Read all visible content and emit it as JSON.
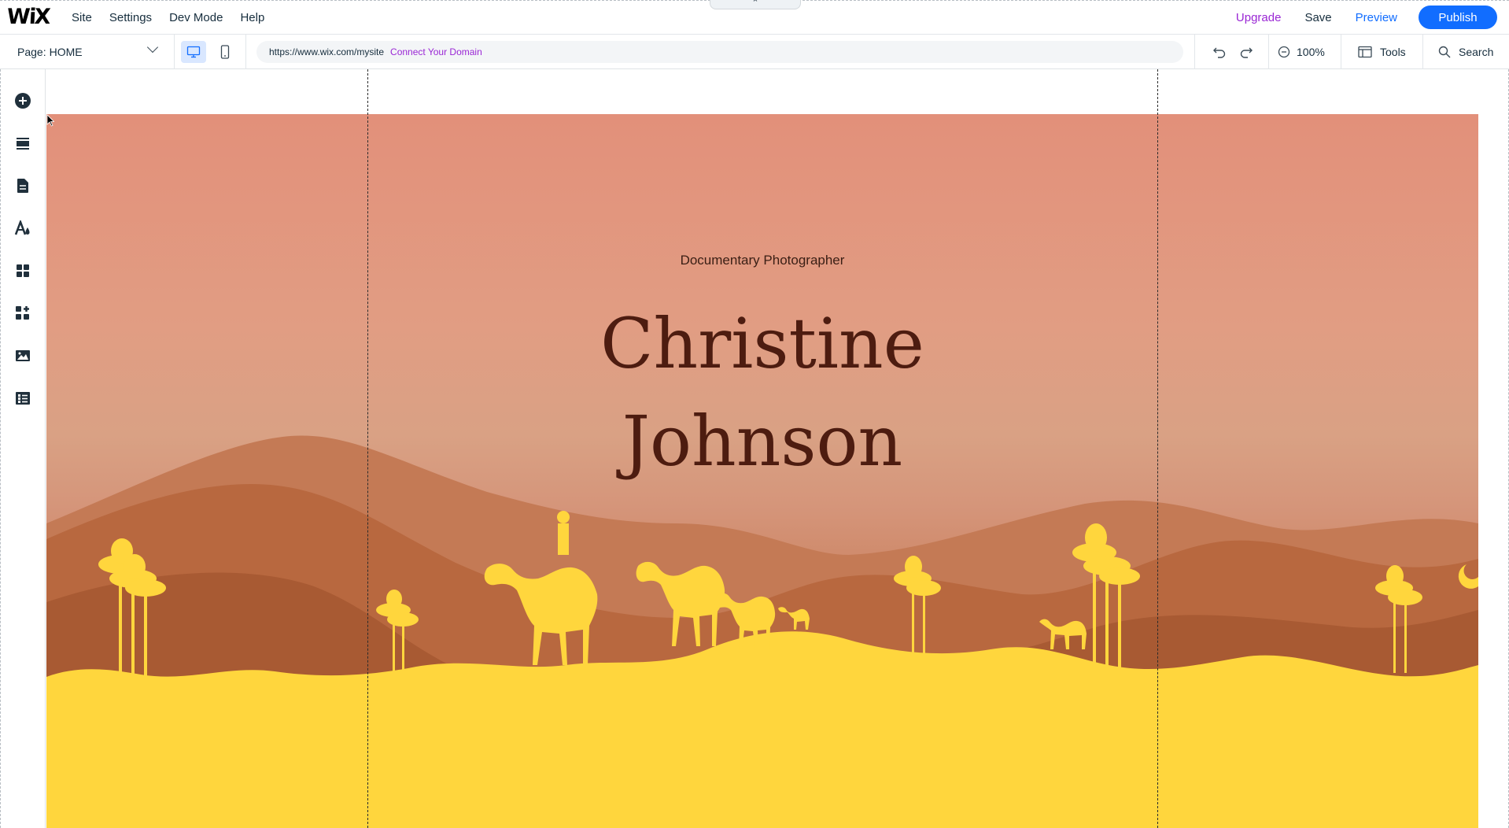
{
  "topbar": {
    "menu": [
      "Site",
      "Settings",
      "Dev Mode",
      "Help"
    ],
    "upgrade": "Upgrade",
    "save": "Save",
    "preview": "Preview",
    "publish": "Publish",
    "collapse_glyph": "⌃"
  },
  "toolbar": {
    "page_label": "Page:",
    "page_value": "HOME",
    "url": "https://www.wix.com/mysite",
    "connect_domain": "Connect Your Domain",
    "zoom": "100%",
    "tools": "Tools",
    "search": "Search"
  },
  "leftbar": {
    "icons": [
      "add-icon",
      "sections-icon",
      "pages-icon",
      "design-icon",
      "apps-icon",
      "app-market-icon",
      "media-icon",
      "cms-icon"
    ]
  },
  "hero": {
    "subtitle": "Documentary Photographer",
    "name_line1": "Christine",
    "name_line2": "Johnson"
  },
  "colors": {
    "accent": "#116dff",
    "upgrade": "#9a27d5",
    "hero_sky": "#e2907a",
    "dunes": "#b86a48",
    "sand": "#ffd63d",
    "name_text": "#4d1c10"
  }
}
